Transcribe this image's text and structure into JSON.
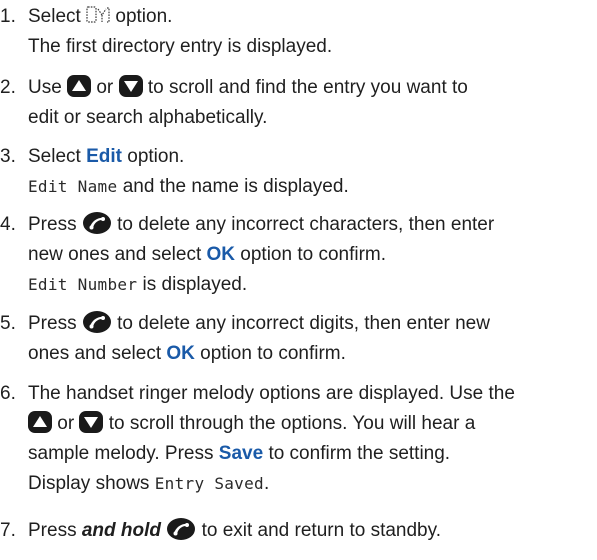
{
  "steps": [
    {
      "number": "1.",
      "line1_a": "Select",
      "line1_b": "option.",
      "line2": "The first directory entry is displayed.",
      "icon": "phonebook-icon"
    },
    {
      "number": "2.",
      "line1_a": "Use",
      "line1_b": "or",
      "line1_c": "to scroll and find the entry you want to",
      "line2": "edit or search alphabetically.",
      "icons": [
        "up-arrow-icon",
        "down-arrow-icon"
      ]
    },
    {
      "number": "3.",
      "line1_a": "Select",
      "line1_bold": "Edit",
      "line1_b": "option.",
      "line2_lcd": "Edit Name",
      "line2_rest": "and the name is displayed."
    },
    {
      "number": "4.",
      "line1_a": "Press",
      "line1_b": "to delete any incorrect characters, then enter",
      "line2_a": "new ones and select",
      "line2_bold": "OK",
      "line2_b": "option to confirm.",
      "line3_lcd": "Edit Number",
      "line3_rest": "is displayed.",
      "icon": "delete-key-icon"
    },
    {
      "number": "5.",
      "line1_a": "Press",
      "line1_b": "to delete any incorrect digits, then enter new",
      "line2_a": "ones and select",
      "line2_bold": "OK",
      "line2_b": "option to confirm.",
      "icon": "delete-key-icon"
    },
    {
      "number": "6.",
      "line1": "The handset ringer melody options are displayed. Use the",
      "line2_a": "or",
      "line2_b": "to scroll through the options. You will hear a",
      "line3_a": "sample melody. Press",
      "line3_bold": "Save",
      "line3_b": "to confirm the setting.",
      "line4_a": "Display shows",
      "line4_lcd": "Entry Saved",
      "line4_b": ".",
      "icons": [
        "up-arrow-icon",
        "down-arrow-icon"
      ]
    },
    {
      "number": "7.",
      "line1_a": "Press",
      "line1_bi": "and hold",
      "line1_b": "to exit and return to standby.",
      "icon": "delete-key-icon"
    }
  ],
  "colors": {
    "text": "#1f1f1f",
    "accent_blue": "#1a5aa8",
    "icon_dark": "#1a1a1a"
  }
}
